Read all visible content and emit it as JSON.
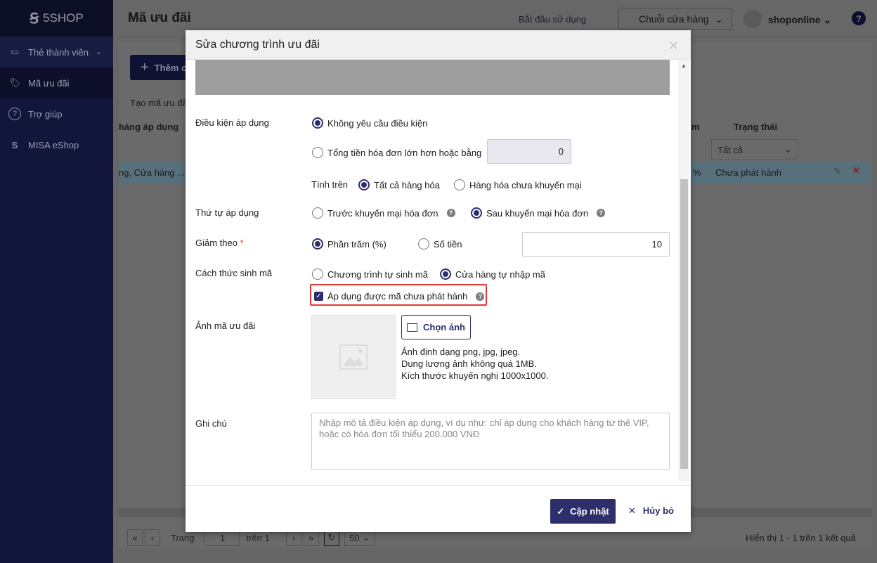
{
  "app": {
    "logo": "5SHOP"
  },
  "sidebar": {
    "items": [
      {
        "label": "Thẻ thành viên"
      },
      {
        "label": "Mã ưu đãi"
      },
      {
        "label": "Trợ giúp"
      },
      {
        "label": "MISA eShop"
      }
    ]
  },
  "header": {
    "title": "Mã ưu đãi",
    "start": "Bắt đầu sử dụng",
    "chain": "Chuỗi cửa hàng",
    "user": "shoponline"
  },
  "page": {
    "add_button": "Thêm c",
    "tab": "Tạo mã ưu đãi",
    "col_store": "hàng áp dụng",
    "col_m": "m",
    "col_status": "Trạng thái",
    "status_filter": "Tất cả",
    "row_store": "ng, Cửa hàng ...",
    "row_pct": "%",
    "row_status": "Chưa phát hành"
  },
  "pagination": {
    "page_label": "Trang",
    "page": "1",
    "of": "trên 1",
    "size": "50",
    "summary": "Hiển thị 1 - 1 trên 1 kết quả"
  },
  "modal": {
    "title": "Sửa chương trình ưu đãi",
    "condition": {
      "label": "Điều kiện áp dụng",
      "opt1": "Không yêu cầu điều kiện",
      "opt2": "Tổng tiền hóa đơn lớn hơn hoặc bằng",
      "amount": "0",
      "calc_label": "Tính trên",
      "calc1": "Tất cả hàng hóa",
      "calc2": "Hàng hóa chưa khuyến mại"
    },
    "order": {
      "label": "Thứ tự áp dụng",
      "opt1": "Trước khuyến mại hóa đơn",
      "opt2": "Sau khuyến mại hóa đơn"
    },
    "discount": {
      "label": "Giảm theo",
      "required": "*",
      "opt1": "Phần trăm (%)",
      "opt2": "Số tiền",
      "value": "10"
    },
    "gen": {
      "label": "Cách thức sinh mã",
      "opt1": "Chương trình tự sinh mã",
      "opt2": "Cửa hàng tự nhập mã",
      "checkbox": "Áp dụng được mã chưa phát hành"
    },
    "image": {
      "label": "Ảnh mã ưu đãi",
      "button": "Chọn ảnh",
      "hint1": "Ảnh định dạng png, jpg, jpeg.",
      "hint2": "Dung lượng ảnh không quá 1MB.",
      "hint3": "Kích thước khuyến nghị 1000x1000."
    },
    "note": {
      "label": "Ghi chú",
      "placeholder": "Nhập mô tả điều kiện áp dụng, ví dụ như: chỉ áp dụng cho khách hàng từ thẻ VIP, hoặc có hóa đơn tối thiểu 200.000 VNĐ"
    },
    "save": "Cập nhật",
    "cancel": "Hủy bỏ"
  },
  "colors": {
    "primary": "#2c2f6b",
    "highlight": "#e53935"
  }
}
